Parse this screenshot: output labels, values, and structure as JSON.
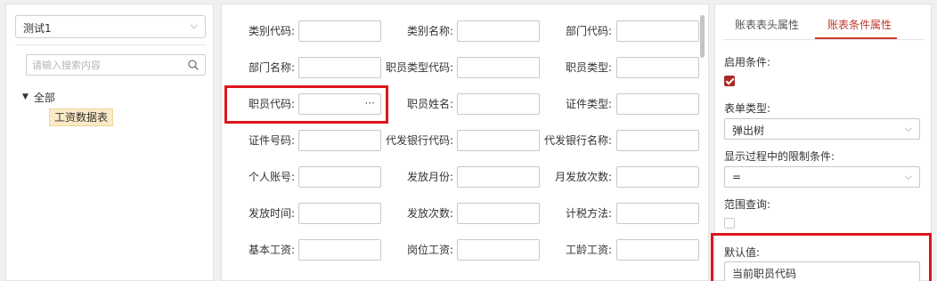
{
  "left": {
    "dataset_value": "测试1",
    "search_placeholder": "请输入搜索内容",
    "tree_root_label": "全部",
    "tree_node_label": "工资数据表"
  },
  "form": {
    "fields": [
      {
        "label": "类别代码:",
        "value": ""
      },
      {
        "label": "类别名称:",
        "value": ""
      },
      {
        "label": "部门代码:",
        "value": ""
      },
      {
        "label": "部门名称:",
        "value": ""
      },
      {
        "label": "职员类型代码:",
        "value": ""
      },
      {
        "label": "职员类型:",
        "value": ""
      },
      {
        "label": "职员代码:",
        "value": "",
        "button": "···"
      },
      {
        "label": "职员姓名:",
        "value": ""
      },
      {
        "label": "证件类型:",
        "value": ""
      },
      {
        "label": "证件号码:",
        "value": ""
      },
      {
        "label": "代发银行代码:",
        "value": ""
      },
      {
        "label": "代发银行名称:",
        "value": ""
      },
      {
        "label": "个人账号:",
        "value": ""
      },
      {
        "label": "发放月份:",
        "value": ""
      },
      {
        "label": "月发放次数:",
        "value": ""
      },
      {
        "label": "发放时间:",
        "value": ""
      },
      {
        "label": "发放次数:",
        "value": ""
      },
      {
        "label": "计税方法:",
        "value": ""
      },
      {
        "label": "基本工资:",
        "value": ""
      },
      {
        "label": "岗位工资:",
        "value": ""
      },
      {
        "label": "工龄工资:",
        "value": ""
      }
    ]
  },
  "props": {
    "tabs": [
      "账表表头属性",
      "账表条件属性"
    ],
    "active_tab_index": 1,
    "enable_condition_label": "启用条件:",
    "enable_condition_checked": true,
    "form_type_label": "表单类型:",
    "form_type_value": "弹出树",
    "process_condition_label": "显示过程中的限制条件:",
    "process_condition_value": "=",
    "range_query_label": "范围查询:",
    "range_query_checked": false,
    "default_value_label": "默认值:",
    "default_value": "当前职员代码"
  },
  "colors": {
    "accent": "#c0392b",
    "highlight": "#e0141c",
    "tree_selected_bg": "#fbeac6"
  }
}
